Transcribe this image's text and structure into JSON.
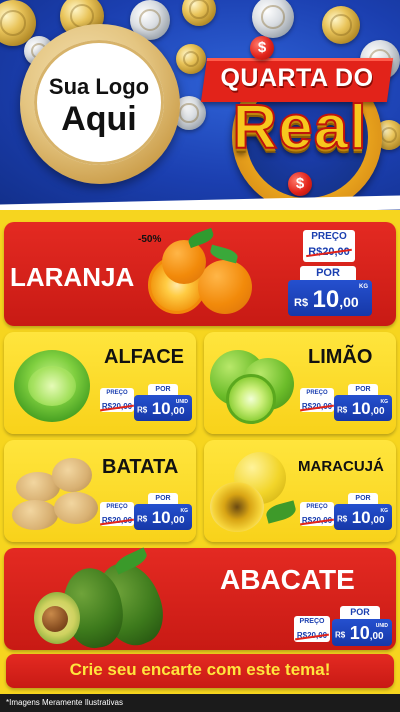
{
  "header": {
    "logo_line1": "Sua Logo",
    "logo_line2": "Aqui",
    "campaign_line1": "QUARTA DO",
    "campaign_line2": "Real",
    "currency_symbol": "$"
  },
  "labels": {
    "preco": "PREÇO",
    "por": "POR",
    "currency": "R$"
  },
  "products": {
    "laranja": {
      "name": "LARANJA",
      "discount": "-50%",
      "old_price": "R$20,00",
      "price_int": "10",
      "price_cents": ",00",
      "unit": "KG"
    },
    "alface": {
      "name": "ALFACE",
      "old_price": "R$20,00",
      "price_int": "10",
      "price_cents": ",00",
      "unit": "UNID"
    },
    "limao": {
      "name": "LIMÃO",
      "old_price": "R$20,00",
      "price_int": "10",
      "price_cents": ",00",
      "unit": "KG"
    },
    "batata": {
      "name": "BATATA",
      "old_price": "R$20,00",
      "price_int": "10",
      "price_cents": ",00",
      "unit": "KG"
    },
    "maracuja": {
      "name": "MARACUJÁ",
      "old_price": "R$20,00",
      "price_int": "10",
      "price_cents": ",00",
      "unit": "KG"
    },
    "abacate": {
      "name": "ABACATE",
      "old_price": "R$20,00",
      "price_int": "10",
      "price_cents": ",00",
      "unit": "UNID"
    }
  },
  "footer": {
    "cta": "Crie seu encarte com este tema!",
    "disclaimer": "*Imagens Meramente Ilustrativas"
  },
  "colors": {
    "red": "#e2231a",
    "yellow": "#f6d51f",
    "blue": "#1b3fb0"
  }
}
